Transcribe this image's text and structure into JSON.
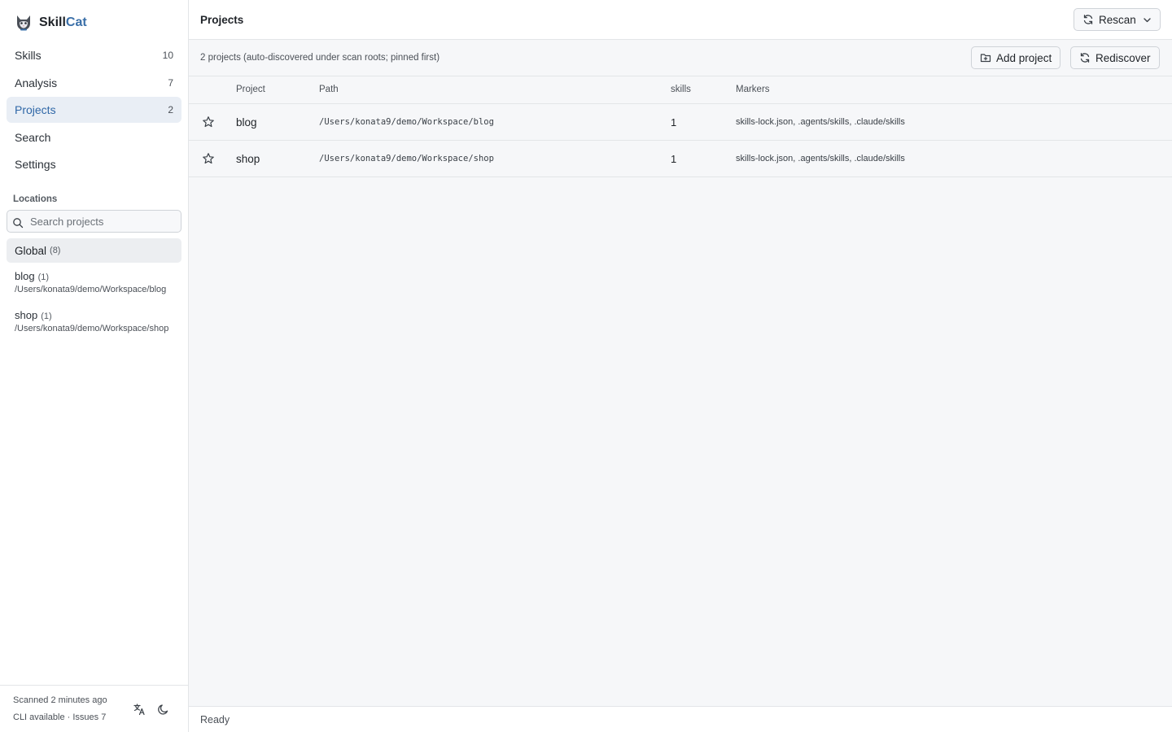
{
  "app": {
    "brand_primary": "Skill",
    "brand_accent": "Cat",
    "accent_color": "#3a6fa8",
    "logo_icon": "cat-logo-icon"
  },
  "sidebar": {
    "nav": [
      {
        "label": "Skills",
        "count": "10",
        "active": false
      },
      {
        "label": "Analysis",
        "count": "7",
        "active": false
      },
      {
        "label": "Projects",
        "count": "2",
        "active": true
      },
      {
        "label": "Search",
        "count": "",
        "active": false
      },
      {
        "label": "Settings",
        "count": "",
        "active": false
      }
    ],
    "locations": {
      "heading": "Locations",
      "search_placeholder": "Search projects",
      "search_icon": "search-icon",
      "global": {
        "label": "Global",
        "count": "(8)"
      },
      "items": [
        {
          "name": "blog",
          "count": "(1)",
          "path": "/Users/konata9/demo/Workspace/blog"
        },
        {
          "name": "shop",
          "count": "(1)",
          "path": "/Users/konata9/demo/Workspace/shop"
        }
      ]
    },
    "footer": {
      "scanned": "Scanned 2 minutes ago",
      "status": "CLI available · Issues 7",
      "language_icon": "translate-icon",
      "theme_icon": "moon-icon"
    }
  },
  "header": {
    "title": "Projects",
    "rescan_label": "Rescan",
    "rescan_icon": "refresh-icon"
  },
  "subbar": {
    "summary": "2 projects (auto-discovered under scan roots; pinned first)",
    "add_project_label": "Add project",
    "add_project_icon": "folder-plus-icon",
    "rediscover_label": "Rediscover",
    "rediscover_icon": "refresh-icon"
  },
  "table": {
    "columns": [
      "Project",
      "Path",
      "skills",
      "Markers"
    ],
    "rows": [
      {
        "name": "blog",
        "path": "/Users/konata9/demo/Workspace/blog",
        "skills": "1",
        "markers": "skills-lock.json, .agents/skills, .claude/skills",
        "pin_icon": "star-icon"
      },
      {
        "name": "shop",
        "path": "/Users/konata9/demo/Workspace/shop",
        "skills": "1",
        "markers": "skills-lock.json, .agents/skills, .claude/skills",
        "pin_icon": "star-icon"
      }
    ]
  },
  "statusbar": {
    "text": "Ready"
  }
}
